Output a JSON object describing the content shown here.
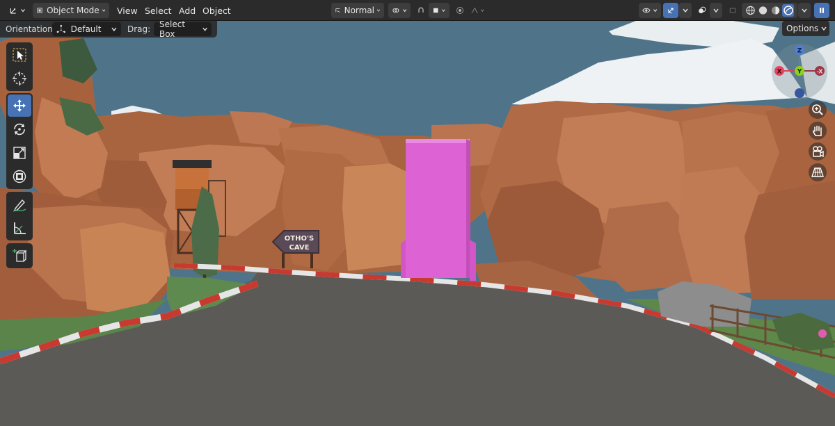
{
  "header": {
    "mode_label": "Object Mode",
    "menus": [
      "View",
      "Select",
      "Add",
      "Object"
    ],
    "transform_orientation": "Normal"
  },
  "tool_settings": {
    "orientation_label": "Orientation:",
    "orientation_value": "Default",
    "drag_label": "Drag:",
    "drag_value": "Select Box",
    "options_label": "Options"
  },
  "gizmo": {
    "z": "Z",
    "y": "Y",
    "x": "X",
    "neg_x": "-X"
  },
  "scene": {
    "sign_line1": "OTHO'S",
    "sign_line2": "CAVE"
  },
  "colors": {
    "accent": "#4772b3",
    "sky": "#4e7389",
    "rock": "#b8714c",
    "portal": "#dd5fd2",
    "road": "#5d5a55"
  },
  "icons": {
    "editor_type": "axis-editor-icon",
    "tools": [
      "select-box-icon",
      "cursor-icon",
      "move-icon",
      "rotate-icon",
      "scale-icon",
      "transform-icon",
      "annotate-icon",
      "measure-icon",
      "add-cube-icon"
    ],
    "nav": [
      "zoom-icon",
      "pan-hand-icon",
      "camera-icon",
      "perspective-grid-icon"
    ]
  }
}
